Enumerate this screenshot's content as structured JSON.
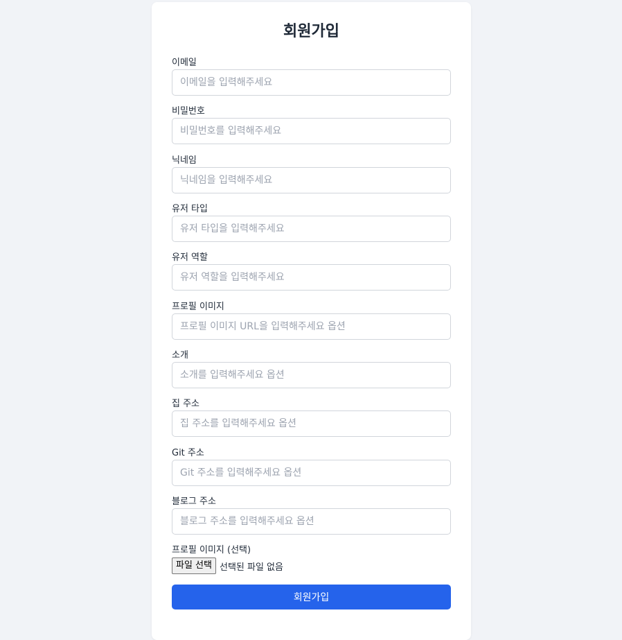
{
  "form": {
    "title": "회원가입",
    "fields": [
      {
        "label": "이메일",
        "placeholder": "이메일을 입력해주세요",
        "value": ""
      },
      {
        "label": "비밀번호",
        "placeholder": "비밀번호를 입력해주세요",
        "value": ""
      },
      {
        "label": "닉네임",
        "placeholder": "닉네임을 입력해주세요",
        "value": ""
      },
      {
        "label": "유저 타입",
        "placeholder": "유저 타입을 입력해주세요",
        "value": ""
      },
      {
        "label": "유저 역할",
        "placeholder": "유저 역할을 입력해주세요",
        "value": ""
      },
      {
        "label": "프로필 이미지",
        "placeholder": "프로필 이미지 URL을 입력해주세요 옵션",
        "value": ""
      },
      {
        "label": "소개",
        "placeholder": "소개를 입력해주세요 옵션",
        "value": ""
      },
      {
        "label": "집 주소",
        "placeholder": "집 주소를 입력해주세요 옵션",
        "value": ""
      },
      {
        "label": "Git 주소",
        "placeholder": "Git 주소를 입력해주세요 옵션",
        "value": ""
      },
      {
        "label": "블로그 주소",
        "placeholder": "블로그 주소를 입력해주세요 옵션",
        "value": ""
      }
    ],
    "file_upload": {
      "label": "프로필 이미지 (선택)",
      "button_label": "파일 선택",
      "status": "선택된 파일 없음"
    },
    "submit_label": "회원가입"
  },
  "colors": {
    "page_background": "#f1f3f7",
    "card_background": "#ffffff",
    "accent": "#2563eb"
  }
}
